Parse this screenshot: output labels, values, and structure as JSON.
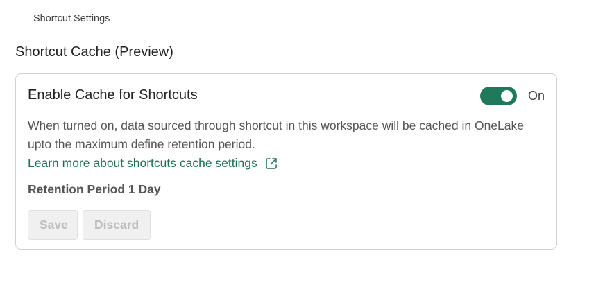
{
  "section_header": {
    "label": "Shortcut Settings"
  },
  "section_title": "Shortcut Cache (Preview)",
  "card": {
    "title": "Enable Cache for Shortcuts",
    "toggle": {
      "state": "on",
      "label": "On",
      "color": "#1f7a5c"
    },
    "description": "When turned on, data sourced through shortcut in this workspace will be cached in OneLake upto the maximum define retention period.",
    "link": {
      "text": "Learn more about shortcuts cache settings",
      "icon": "external-link-icon"
    },
    "retention_label": "Retention Period 1 Day",
    "buttons": {
      "save": "Save",
      "discard": "Discard"
    }
  }
}
